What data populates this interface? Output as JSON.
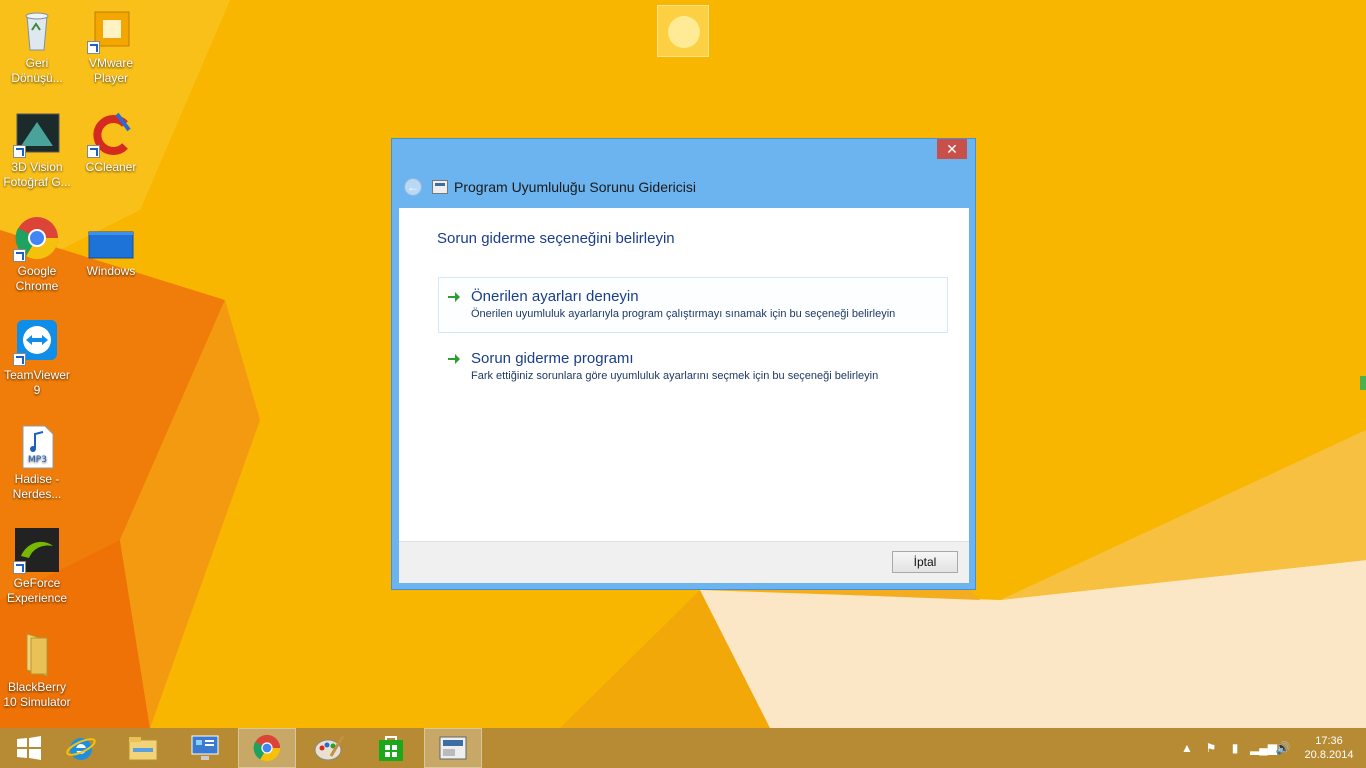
{
  "desktop": {
    "icons": [
      {
        "label": "Geri Dönüşü..."
      },
      {
        "label": "VMware Player"
      },
      {
        "label": "3D Vision Fotoğraf G..."
      },
      {
        "label": "CCleaner"
      },
      {
        "label": "Google Chrome"
      },
      {
        "label": "Windows"
      },
      {
        "label": "TeamViewer 9"
      },
      {
        "label": "Hadise - Nerdes..."
      },
      {
        "label": "GeForce Experience"
      },
      {
        "label": "BlackBerry 10 Simulator"
      }
    ]
  },
  "window": {
    "close_glyph": "✕",
    "title": "Program Uyumluluğu Sorunu Gidericisi",
    "heading": "Sorun giderme seçeneğini belirleyin",
    "options": [
      {
        "title": "Önerilen ayarları deneyin",
        "desc": "Önerilen uyumluluk ayarlarıyla program çalıştırmayı sınamak için bu seçeneği belirleyin"
      },
      {
        "title": "Sorun giderme programı",
        "desc": "Fark ettiğiniz sorunlara göre uyumluluk ayarlarını seçmek için bu seçeneği belirleyin"
      }
    ],
    "cancel_label": "İptal"
  },
  "taskbar": {
    "items": [
      "start-icon",
      "internet-explorer-icon",
      "file-explorer-icon",
      "control-panel-icon",
      "chrome-icon",
      "paint-icon",
      "store-icon",
      "troubleshooter-icon"
    ],
    "active_item": "troubleshooter-icon",
    "clock": {
      "time": "17:36",
      "date": "20.8.2014"
    }
  },
  "colors": {
    "wallpaper": "#f7b500",
    "window_frame": "#6cb4f0",
    "heading_text": "#1a3e8c",
    "close": "#c7504a"
  }
}
